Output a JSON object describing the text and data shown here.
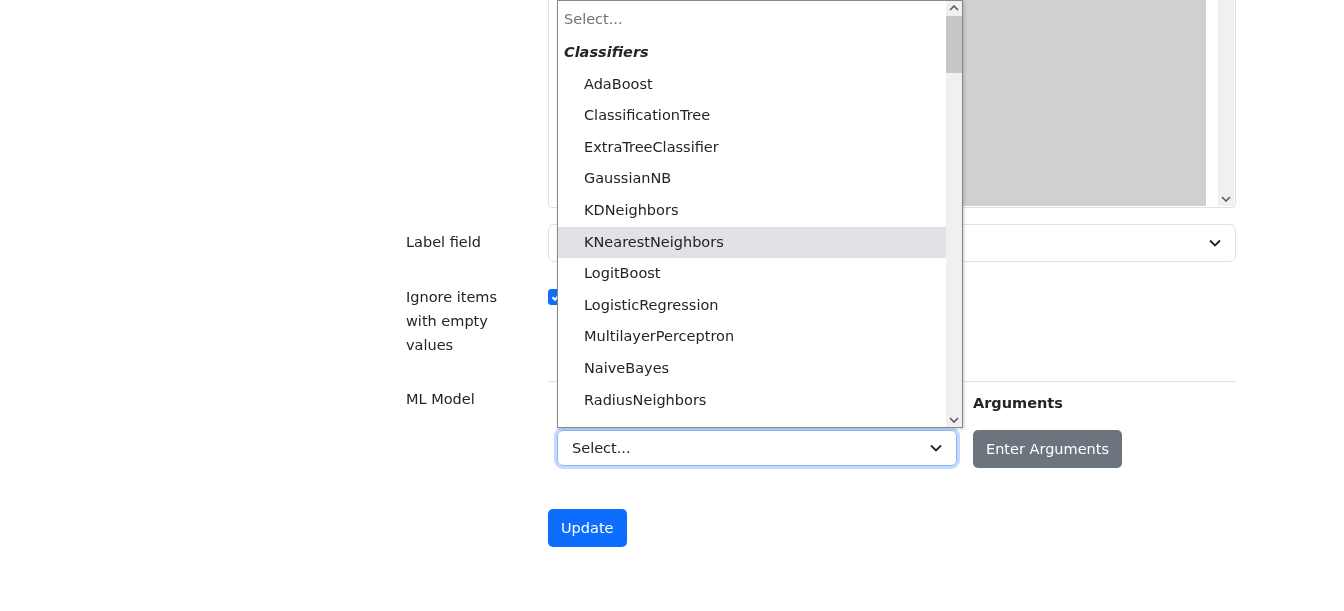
{
  "form": {
    "label_field": {
      "label": "Label field"
    },
    "ignore_empty": {
      "label": "Ignore items with empty values",
      "checked": true
    },
    "ml_model": {
      "label": "ML Model",
      "select_value": "Select...",
      "arguments_heading": "Arguments",
      "arguments_button": "Enter Arguments"
    },
    "update_button": "Update"
  },
  "dropdown": {
    "placeholder": "Select...",
    "groups": [
      {
        "label": "Classifiers",
        "options": [
          {
            "label": "AdaBoost",
            "selected": false
          },
          {
            "label": "ClassificationTree",
            "selected": false
          },
          {
            "label": "ExtraTreeClassifier",
            "selected": false
          },
          {
            "label": "GaussianNB",
            "selected": false
          },
          {
            "label": "KDNeighbors",
            "selected": false
          },
          {
            "label": "KNearestNeighbors",
            "selected": true
          },
          {
            "label": "LogitBoost",
            "selected": false
          },
          {
            "label": "LogisticRegression",
            "selected": false
          },
          {
            "label": "MultilayerPerceptron",
            "selected": false
          },
          {
            "label": "NaiveBayes",
            "selected": false
          },
          {
            "label": "RadiusNeighbors",
            "selected": false
          }
        ]
      }
    ]
  }
}
